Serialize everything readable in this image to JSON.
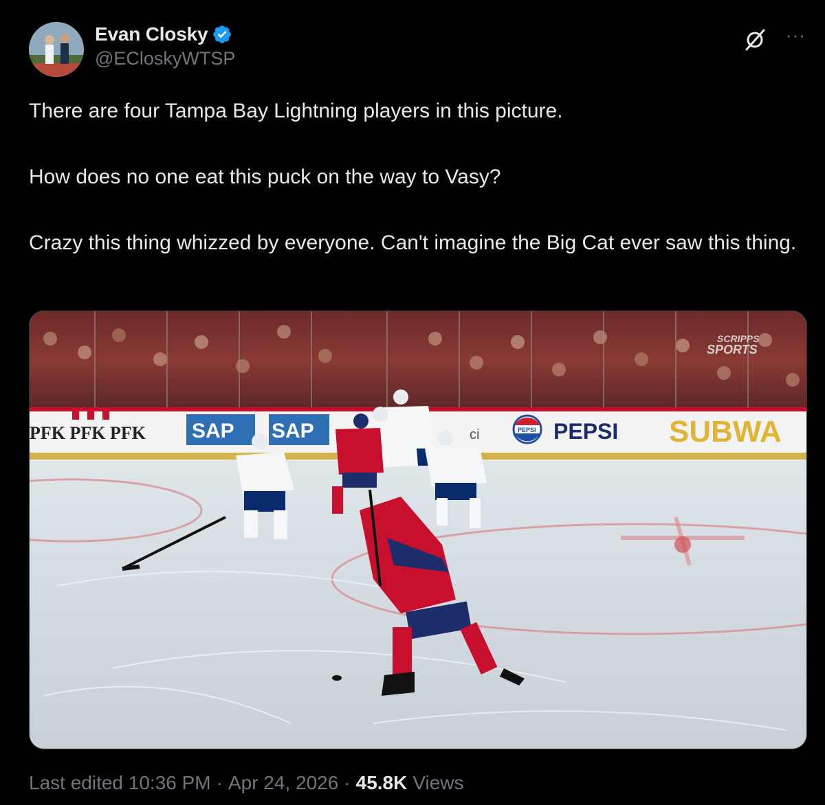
{
  "author": {
    "display_name": "Evan Closky",
    "handle": "@ECloskyWTSP",
    "verified": true,
    "avatar_icon": "profile-photo"
  },
  "tweet": {
    "paragraphs": [
      "There are four Tampa Bay Lightning players in this picture.",
      "How does no one eat this puck on the way to Vasy?",
      "Crazy this thing whizzed by everyone. Can't imagine the Big Cat ever saw this thing."
    ]
  },
  "media": {
    "type": "image",
    "watermark_line1": "SCRIPPS",
    "watermark_line2": "SPORTS",
    "board_ads": {
      "pfk": "PFK PFK PFK",
      "sap1": "SAP",
      "sap2": "SAP",
      "ci": "ci",
      "pepsi_logo": "PEPSI",
      "pepsi": "PEPSI",
      "subway": "SUBWA"
    }
  },
  "footer": {
    "edited_label": "Last edited 10:36 PM",
    "separator": "·",
    "date": "Apr 24, 2026",
    "views_count": "45.8K",
    "views_label": "Views"
  },
  "colors": {
    "background": "#000000",
    "text_primary": "#e7e9ea",
    "text_secondary": "#71767b",
    "verified": "#1d9bf0",
    "canadiens_red": "#c8102e",
    "lightning_blue": "#002868"
  },
  "icons": {
    "verified": "verified-badge-icon",
    "grok": "grok-icon",
    "more": "more-options-icon"
  }
}
